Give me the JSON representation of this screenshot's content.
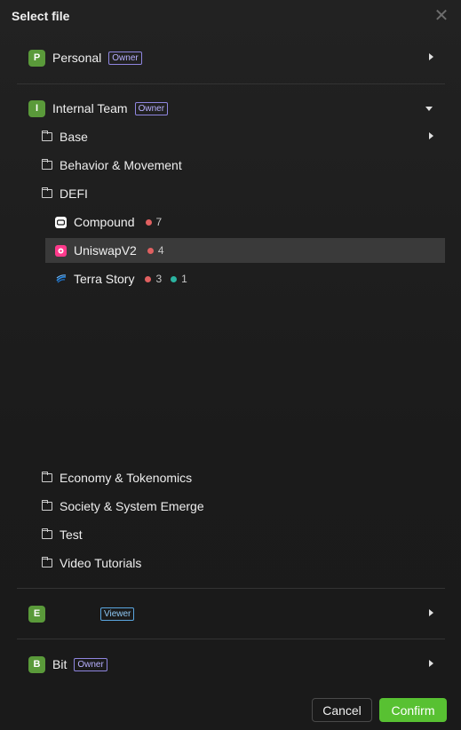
{
  "dialog": {
    "title": "Select file"
  },
  "workspaces": [
    {
      "badge": "P",
      "name": "Personal",
      "role": "Owner",
      "expanded": false
    },
    {
      "badge": "I",
      "name": "Internal Team",
      "role": "Owner",
      "expanded": true
    },
    {
      "badge": "E",
      "name": "",
      "role": "Viewer",
      "expanded": false
    },
    {
      "badge": "B",
      "name": "Bit",
      "role": "Owner",
      "expanded": false
    }
  ],
  "folders": {
    "base": "Base",
    "behavior": "Behavior & Movement",
    "defi": "DEFI",
    "economy": "Economy & Tokenomics",
    "society": "Society & System Emerge",
    "test": "Test",
    "video": "Video Tutorials"
  },
  "files": [
    {
      "name": "Compound",
      "red_count": "7"
    },
    {
      "name": "UniswapV2",
      "red_count": "4"
    },
    {
      "name": "Terra Story",
      "red_count": "3",
      "teal_count": "1"
    }
  ],
  "buttons": {
    "cancel": "Cancel",
    "confirm": "Confirm"
  },
  "colors": {
    "accent": "#58c132",
    "badge": "#5a9a3a",
    "selected_row": "#3a3a3a"
  }
}
